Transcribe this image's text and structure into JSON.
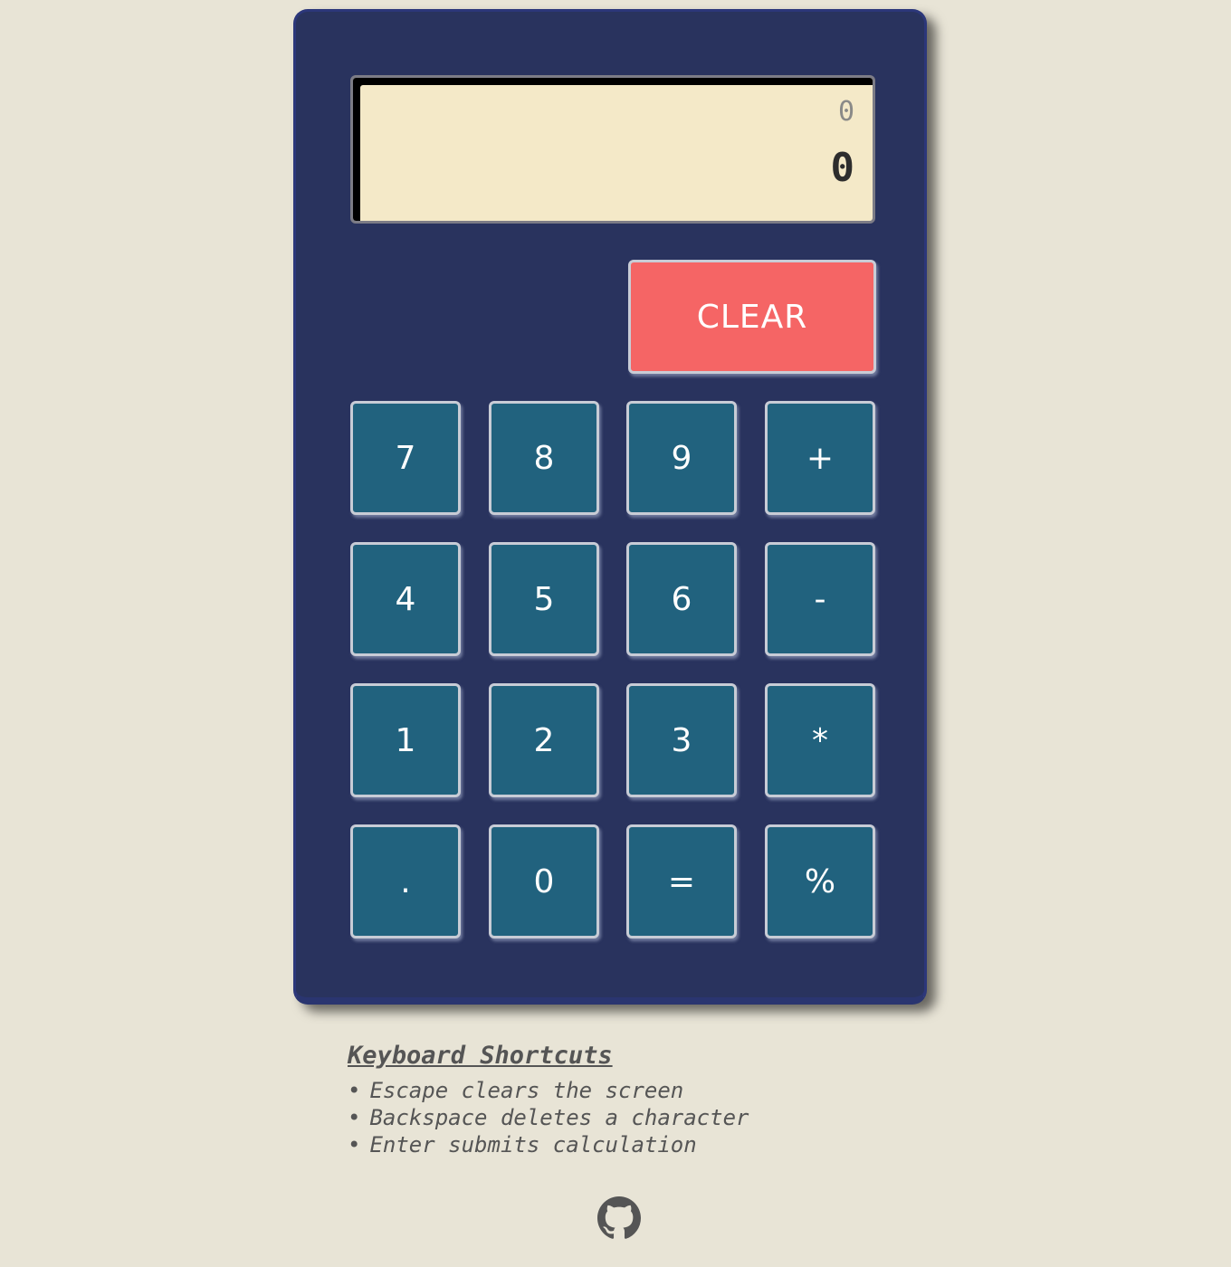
{
  "display": {
    "previous": "0",
    "current": "0"
  },
  "keys": {
    "clear": "CLEAR",
    "k7": "7",
    "k8": "8",
    "k9": "9",
    "add": "+",
    "k4": "4",
    "k5": "5",
    "k6": "6",
    "sub": "-",
    "k1": "1",
    "k2": "2",
    "k3": "3",
    "mul": "*",
    "dot": ".",
    "k0": "0",
    "eq": "=",
    "pct": "%"
  },
  "shortcuts": {
    "title": "Keyboard Shortcuts",
    "items": [
      "Escape clears the screen",
      "Backspace deletes a character",
      "Enter submits calculation"
    ]
  },
  "footer": {
    "icon": "github-icon"
  },
  "colors": {
    "background": "#e8e4d6",
    "body": "#29335e",
    "key": "#21627e",
    "clear": "#f56565",
    "display": "#f4e9c8"
  }
}
